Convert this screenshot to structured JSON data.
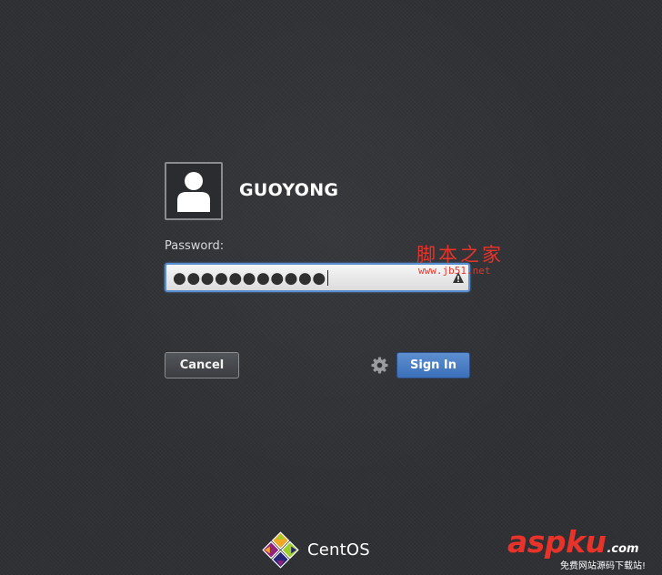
{
  "user": {
    "name": "GUOYONG",
    "avatar_icon": "user-silhouette-icon"
  },
  "password": {
    "label": "Password:",
    "masked_value": "●●●●●●●●●●●",
    "capslock_icon": "caps-lock-warning-icon"
  },
  "buttons": {
    "cancel_label": "Cancel",
    "signin_label": "Sign In",
    "settings_icon": "gear-icon"
  },
  "branding": {
    "os_name": "CentOS",
    "logo_icon": "centos-logo-icon"
  },
  "watermarks": {
    "cn_title": "脚本之家",
    "cn_url": "www.jb51.net",
    "aspku_name": "aspku",
    "aspku_suffix": ".com",
    "aspku_tagline": "免费网站源码下载站!"
  },
  "colors": {
    "background": "#2e3034",
    "signin_button": "#3b6fb8",
    "focus_border": "#5a8fd0",
    "watermark_red": "#e8332a"
  }
}
